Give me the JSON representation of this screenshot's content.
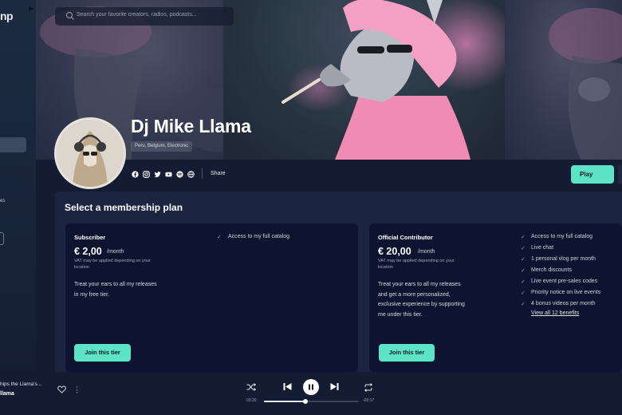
{
  "app": {
    "logo_text": "np"
  },
  "sidebar": {
    "partial_label": "es"
  },
  "search": {
    "placeholder": "Search your favorite creators, radios, podcasts..."
  },
  "artist": {
    "name": "Dj Mike Llama",
    "tags": "Peru, Belgium, Electronic",
    "socials": [
      "facebook-icon",
      "instagram-icon",
      "twitter-icon",
      "youtube-icon",
      "spotify-icon",
      "website-icon"
    ],
    "share_label": "Share",
    "play_label": "Play"
  },
  "membership": {
    "title": "Select a membership plan",
    "plans": [
      {
        "name": "Subscriber",
        "price": "€ 2,00",
        "period": "/month",
        "vat_note": "VAT may be applied depending on your location",
        "description": "Treat your ears to all my releases in my free tier.",
        "join_label": "Join this tier",
        "benefits": [
          "Access to my full catalog"
        ]
      },
      {
        "name": "Official Contributor",
        "price": "€ 20,00",
        "period": "/month",
        "vat_note": "VAT may be applied depending on your location",
        "description": "Treat your ears to all my releases and get a more personalized, exclusive experience by supporting me under this tier.",
        "join_label": "Join this tier",
        "benefits": [
          "Access to my full catalog",
          "Live chat",
          "1 personal vlog per month",
          "Merch discounts",
          "Live event pre-sales codes",
          "Priority notice on live events",
          "4 bonus videos per month"
        ],
        "view_all": "View all 12 benefits"
      }
    ]
  },
  "player": {
    "now_playing_title": "hips the Llama's...",
    "now_playing_artist": "llama",
    "time_current": "03:20",
    "time_remaining": "-03:17",
    "progress": 0.44
  },
  "colors": {
    "accent": "#5de3c5",
    "background": "#141c33",
    "panel": "#1b2540",
    "card": "#0e1430"
  }
}
